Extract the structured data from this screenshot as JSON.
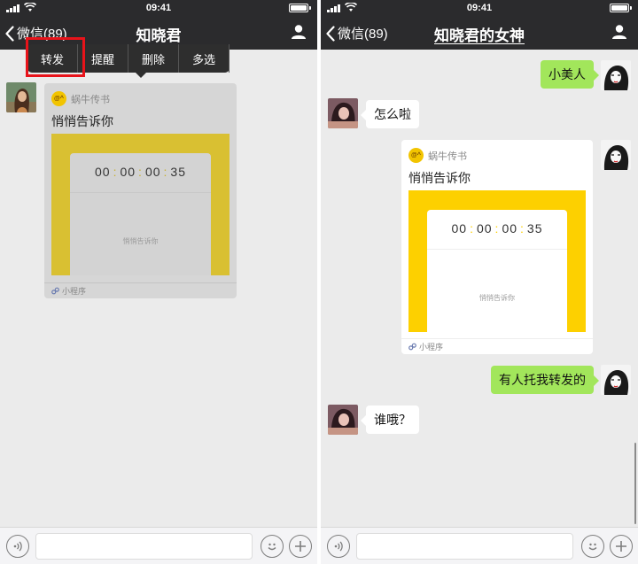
{
  "left_screen": {
    "status": {
      "time": "09:41"
    },
    "nav": {
      "back_label": "微信(89)",
      "title": "知晓君"
    },
    "context_menu": {
      "items": [
        "转发",
        "提醒",
        "删除",
        "多选"
      ]
    },
    "card": {
      "app_name": "蜗牛传书",
      "logo_text": "@^",
      "title": "悄悄告诉你",
      "timer": [
        "00",
        "00",
        "00",
        "35"
      ],
      "ghost_text": "悄悄告诉你",
      "footer": "小程序"
    }
  },
  "right_screen": {
    "status": {
      "time": "09:41"
    },
    "nav": {
      "back_label": "微信(89)",
      "title": "知晓君的女神"
    },
    "messages": {
      "m1": "小美人",
      "m2": "怎么啦",
      "m4": "有人托我转发的",
      "m5": "谁哦？"
    },
    "card": {
      "app_name": "蜗牛传书",
      "logo_text": "@^",
      "title": "悄悄告诉你",
      "timer": [
        "00",
        "00",
        "00",
        "35"
      ],
      "ghost_text": "悄悄告诉你",
      "footer": "小程序"
    }
  },
  "colors": {
    "nav_bg": "#2b2b2d",
    "chat_bg": "#ebebeb",
    "bubble_green": "#a2e65b",
    "card_yellow": "#fdd000",
    "highlight_red": "#e8131a"
  },
  "icons": [
    "signal-icon",
    "wifi-icon",
    "battery-icon",
    "back-chevron-icon",
    "person-icon",
    "miniprogram-link-icon",
    "voice-icon",
    "emoji-icon",
    "plus-icon"
  ]
}
